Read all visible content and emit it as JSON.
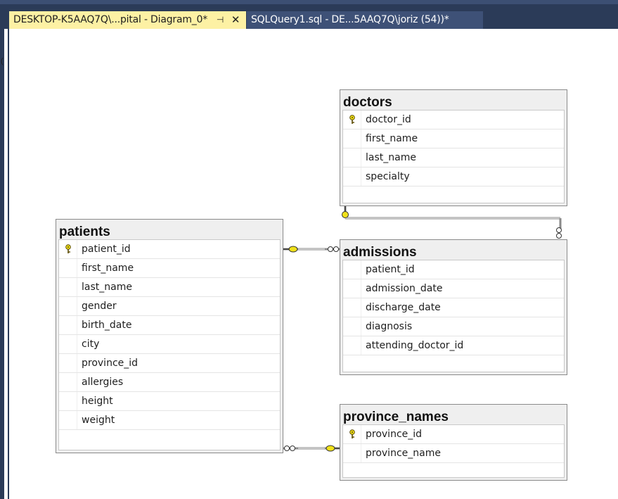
{
  "tabs": [
    {
      "label": "DESKTOP-K5AAQ7Q\\...pital - Diagram_0*",
      "pin": "⊣",
      "close": "✕"
    },
    {
      "label": "SQLQuery1.sql - DE...5AAQ7Q\\joriz (54))*"
    }
  ],
  "left_glyph": "(",
  "colors": {
    "active_tab": "#fdf1a4",
    "inactive_tab": "#3e5177",
    "chrome": "#2b3b58",
    "key_fill": "#f0e11a",
    "relationship_line": "#8a8a8a"
  },
  "tables": {
    "doctors": {
      "title": "doctors",
      "columns": [
        {
          "name": "doctor_id",
          "primary_key": true
        },
        {
          "name": "first_name"
        },
        {
          "name": "last_name"
        },
        {
          "name": "specialty"
        }
      ]
    },
    "patients": {
      "title": "patients",
      "columns": [
        {
          "name": "patient_id",
          "primary_key": true
        },
        {
          "name": "first_name"
        },
        {
          "name": "last_name"
        },
        {
          "name": "gender"
        },
        {
          "name": "birth_date"
        },
        {
          "name": "city"
        },
        {
          "name": "province_id"
        },
        {
          "name": "allergies"
        },
        {
          "name": "height"
        },
        {
          "name": "weight"
        }
      ]
    },
    "admissions": {
      "title": "admissions",
      "columns": [
        {
          "name": "patient_id"
        },
        {
          "name": "admission_date"
        },
        {
          "name": "discharge_date"
        },
        {
          "name": "diagnosis"
        },
        {
          "name": "attending_doctor_id"
        }
      ]
    },
    "province_names": {
      "title": "province_names",
      "columns": [
        {
          "name": "province_id",
          "primary_key": true
        },
        {
          "name": "province_name"
        }
      ]
    }
  },
  "relationships": [
    {
      "from": "doctors",
      "to": "admissions",
      "one_end": "key-icon",
      "many_end": "infinity-icon"
    },
    {
      "from": "patients",
      "to": "admissions",
      "one_end": "key-icon",
      "many_end": "infinity-icon"
    },
    {
      "from": "province_names",
      "to": "patients",
      "one_end": "key-icon",
      "many_end": "infinity-icon"
    }
  ]
}
